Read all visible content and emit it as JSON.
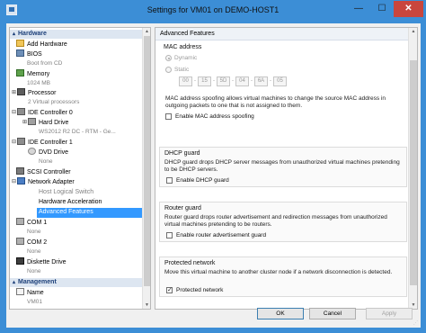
{
  "window": {
    "title": "Settings for VM01 on DEMO-HOST1",
    "minimize_glyph": "—",
    "maximize_glyph": "☐",
    "close_glyph": "✕"
  },
  "tree": {
    "hardware_header": "Hardware",
    "management_header": "Management",
    "items": [
      {
        "label": "Add Hardware",
        "sub": ""
      },
      {
        "label": "BIOS",
        "sub": "Boot from CD"
      },
      {
        "label": "Memory",
        "sub": "1024 MB"
      },
      {
        "label": "Processor",
        "sub": "2 Virtual processors"
      },
      {
        "label": "IDE Controller 0",
        "sub": ""
      },
      {
        "label": "Hard Drive",
        "sub": "WS2012 R2 DC - RTM - Ge..."
      },
      {
        "label": "IDE Controller 1",
        "sub": ""
      },
      {
        "label": "DVD Drive",
        "sub": "None"
      },
      {
        "label": "SCSI Controller",
        "sub": ""
      },
      {
        "label": "Network Adapter",
        "sub": ""
      },
      {
        "label": "Host Logical Switch",
        "sub": ""
      },
      {
        "label": "Hardware Acceleration",
        "sub": ""
      },
      {
        "label": "Advanced Features",
        "sub": ""
      },
      {
        "label": "COM 1",
        "sub": "None"
      },
      {
        "label": "COM 2",
        "sub": "None"
      },
      {
        "label": "Diskette Drive",
        "sub": "None"
      },
      {
        "label": "Name",
        "sub": "VM01"
      }
    ]
  },
  "panel": {
    "header": "Advanced Features",
    "mac": {
      "title": "MAC address",
      "dynamic_label": "Dynamic",
      "static_label": "Static",
      "octets": [
        "00",
        "15",
        "5D",
        "04",
        "6A",
        "05"
      ],
      "spoofing_desc": "MAC address spoofing allows virtual machines to change the source MAC address in outgoing packets to one that is not assigned to them.",
      "spoofing_label": "Enable MAC address spoofing"
    },
    "dhcp": {
      "title": "DHCP guard",
      "desc": "DHCP guard drops DHCP server messages from unauthorized virtual machines pretending to be DHCP servers.",
      "label": "Enable DHCP guard"
    },
    "router": {
      "title": "Router guard",
      "desc": "Router guard drops router advertisement and redirection messages from unauthorized virtual machines pretending to be routers.",
      "label": "Enable router advertisement guard"
    },
    "protected": {
      "title": "Protected network",
      "desc": "Move this virtual machine to another cluster node if a network disconnection is detected.",
      "label": "Protected network",
      "checked": true
    }
  },
  "buttons": {
    "ok": "OK",
    "cancel": "Cancel",
    "apply": "Apply"
  }
}
